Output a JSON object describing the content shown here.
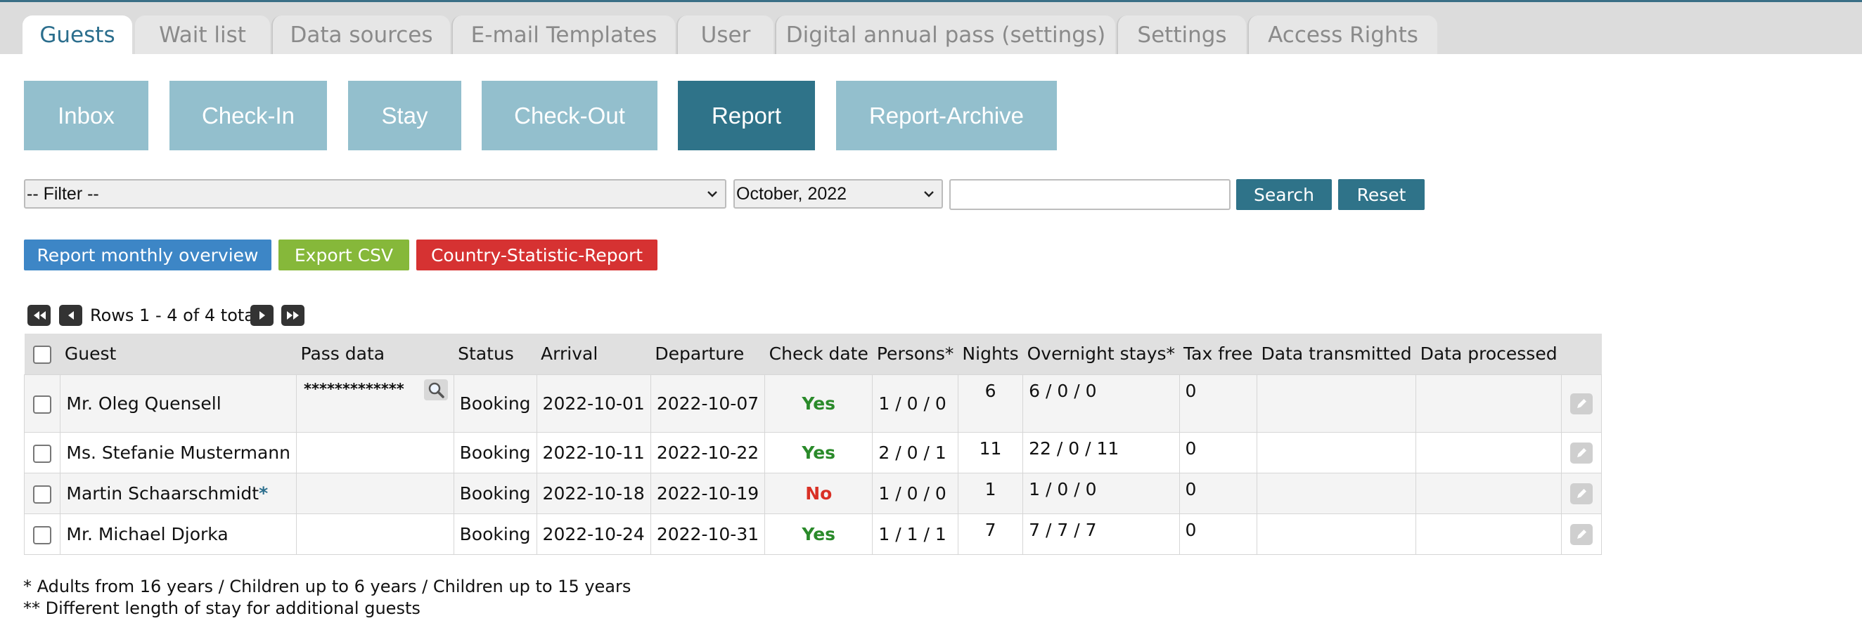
{
  "tabs": [
    {
      "label": "Guests",
      "active": true
    },
    {
      "label": "Wait list"
    },
    {
      "label": "Data sources"
    },
    {
      "label": "E-mail Templates"
    },
    {
      "label": "User"
    },
    {
      "label": "Digital annual pass (settings)"
    },
    {
      "label": "Settings"
    },
    {
      "label": "Access Rights"
    }
  ],
  "nav": {
    "inbox": "Inbox",
    "checkin": "Check-In",
    "stay": "Stay",
    "checkout": "Check-Out",
    "report": "Report",
    "report_archive": "Report-Archive"
  },
  "filter": {
    "filter_selected": "-- Filter --",
    "month_selected": "October, 2022",
    "search_value": "",
    "search_label": "Search",
    "reset_label": "Reset"
  },
  "actions": {
    "monthly": "Report monthly overview",
    "export": "Export CSV",
    "country": "Country-Statistic-Report"
  },
  "pagination": {
    "info": "Rows 1 - 4 of 4 total"
  },
  "table": {
    "headers": [
      "Guest",
      "Pass data",
      "Status",
      "Arrival",
      "Departure",
      "Check date",
      "Persons*",
      "Nights",
      "Overnight stays*",
      "Tax free",
      "Data transmitted",
      "Data processed"
    ],
    "rows": [
      {
        "guest": "Mr. Oleg Quensell",
        "star": "",
        "pass": "*************",
        "status": "Booking",
        "arrival": "2022-10-01",
        "departure": "2022-10-07",
        "check": "Yes",
        "persons": "1 / 0 / 0",
        "nights": "6",
        "overnight": "6 / 0 / 0",
        "taxfree": "0",
        "transmitted": "",
        "processed": ""
      },
      {
        "guest": "Ms. Stefanie Mustermann",
        "star": "",
        "pass": "",
        "status": "Booking",
        "arrival": "2022-10-11",
        "departure": "2022-10-22",
        "check": "Yes",
        "persons": "2 / 0 / 1",
        "nights": "11",
        "overnight": "22 / 0 / 11",
        "taxfree": "0",
        "transmitted": "",
        "processed": ""
      },
      {
        "guest": "Martin Schaarschmidt",
        "star": "*",
        "pass": "",
        "status": "Booking",
        "arrival": "2022-10-18",
        "departure": "2022-10-19",
        "check": "No",
        "persons": "1 / 0 / 0",
        "nights": "1",
        "overnight": "1 / 0 / 0",
        "taxfree": "0",
        "transmitted": "",
        "processed": ""
      },
      {
        "guest": "Mr. Michael Djorka",
        "star": "",
        "pass": "",
        "status": "Booking",
        "arrival": "2022-10-24",
        "departure": "2022-10-31",
        "check": "Yes",
        "persons": "1 / 1 / 1",
        "nights": "7",
        "overnight": "7 / 7 / 7",
        "taxfree": "0",
        "transmitted": "",
        "processed": ""
      }
    ]
  },
  "footnotes": {
    "note1": "* Adults from 16 years / Children up to 6 years / Children up to 15 years",
    "note2": "** Different length of stay for additional guests"
  },
  "colors": {
    "primary": "#2f7389",
    "nav_inactive": "#93bfcd",
    "monthly": "#3d86c6",
    "export": "#86b83a",
    "country": "#d63232",
    "yes": "#2a8a2a",
    "no": "#d93025"
  }
}
